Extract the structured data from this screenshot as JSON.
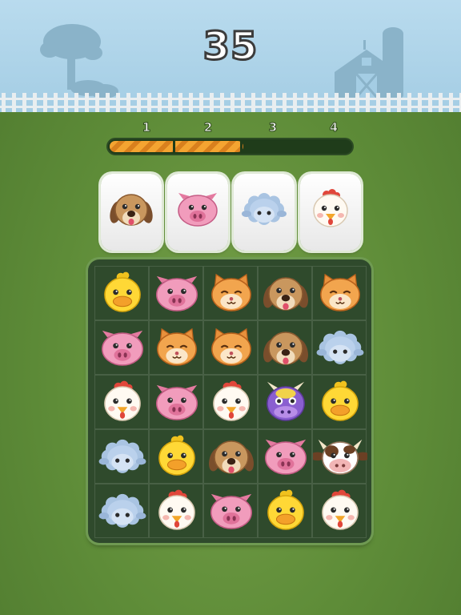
{
  "score": "35",
  "levels": [
    "1",
    "2",
    "3",
    "4"
  ],
  "progress_fraction": 0.63,
  "goal_animals": [
    "dog",
    "pig",
    "sheep",
    "chicken"
  ],
  "board": [
    [
      "chick",
      "pig",
      "cat",
      "dog",
      "cat"
    ],
    [
      "pig",
      "cat",
      "cat",
      "dog",
      "sheep"
    ],
    [
      "chicken",
      "pig",
      "chicken",
      "purple-cow",
      "chick"
    ],
    [
      "sheep",
      "chick",
      "dog",
      "pig",
      "cow"
    ],
    [
      "sheep",
      "chicken",
      "pig",
      "chick",
      "chicken"
    ]
  ],
  "colors": {
    "sky": "#a4cde4",
    "grass": "#5e8c38",
    "board": "#2f4a2c",
    "progress_fill": "#f4a431"
  }
}
